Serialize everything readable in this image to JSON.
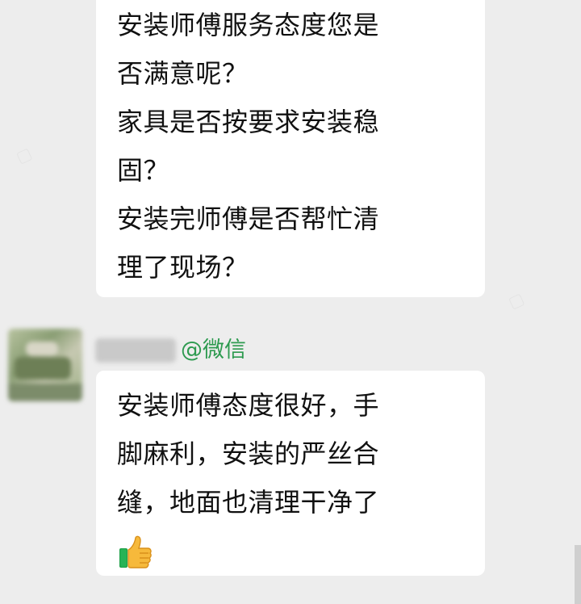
{
  "messages": [
    {
      "lines": [
        "安装师傅服务态度您是",
        "否满意呢？",
        "家具是否按要求安装稳",
        "固？",
        "安装完师傅是否帮忙清",
        "理了现场？"
      ]
    },
    {
      "sender_tag": "@微信",
      "lines": [
        "安装师傅态度很好，手",
        "脚麻利，安装的严丝合",
        "缝，地面也清理干净了"
      ],
      "emoji": "thumbs-up-icon"
    }
  ],
  "colors": {
    "background": "#ededed",
    "bubble": "#ffffff",
    "tag": "#2d9a4f"
  }
}
